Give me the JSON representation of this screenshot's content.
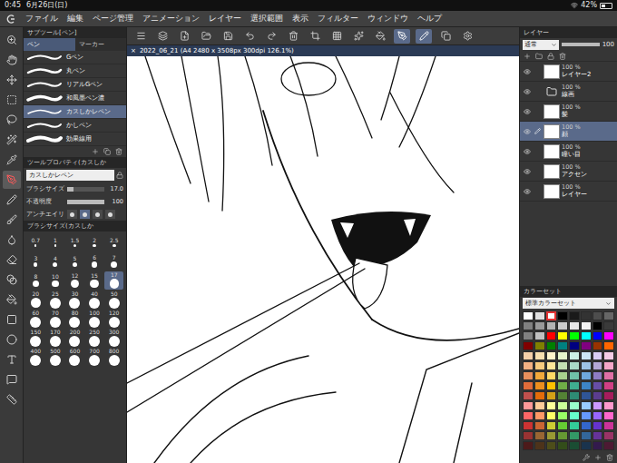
{
  "status_bar": {
    "time": "0:45",
    "date": "6月26日(日)",
    "battery": "42%",
    "battery_level": 0.42
  },
  "menu": {
    "items": [
      "ファイル",
      "編集",
      "ページ管理",
      "アニメーション",
      "レイヤー",
      "選択範囲",
      "表示",
      "フィルター",
      "ウィンドウ",
      "ヘルプ"
    ]
  },
  "tools": [
    {
      "selected": false
    },
    {
      "selected": false
    },
    {
      "selected": false
    },
    {
      "selected": false
    },
    {
      "selected": false
    },
    {
      "selected": false
    },
    {
      "selected": false
    },
    {
      "selected": true
    },
    {
      "selected": false
    },
    {
      "selected": false
    },
    {
      "selected": false
    },
    {
      "selected": false
    },
    {
      "selected": false
    },
    {
      "selected": false
    },
    {
      "selected": false
    },
    {
      "selected": false
    },
    {
      "selected": false
    },
    {
      "selected": false
    },
    {
      "selected": false
    }
  ],
  "toolbar": [
    {
      "selected": false
    },
    {
      "selected": false
    },
    {
      "selected": false
    },
    {
      "selected": false
    },
    {
      "selected": false
    },
    {
      "selected": false
    },
    {
      "selected": false
    },
    {
      "selected": false
    },
    {
      "selected": false
    },
    {
      "selected": false
    },
    {
      "selected": false
    },
    {
      "selected": false
    },
    {
      "selected": true
    },
    {
      "selected": true
    },
    {
      "selected": false
    },
    {
      "selected": false
    }
  ],
  "canvas": {
    "tab_close": "×",
    "title": "2022_06_21 (A4 2480 x 3508px 300dpi 126.1%)"
  },
  "subtool_panel": {
    "title": "サブツール[ペン]",
    "tabs": [
      {
        "label": "ペン",
        "selected": true
      },
      {
        "label": "マーカー",
        "selected": false
      }
    ],
    "brushes": [
      {
        "name": "Gペン",
        "selected": false
      },
      {
        "name": "丸ペン",
        "selected": false
      },
      {
        "name": "リアルGペン",
        "selected": false
      },
      {
        "name": "和風墨ペン濃",
        "selected": false
      },
      {
        "name": "カスしかレペン",
        "selected": true
      },
      {
        "name": "かしペン",
        "selected": false
      },
      {
        "name": "効果線用",
        "selected": false
      }
    ]
  },
  "tool_property": {
    "title": "ツールプロパティ(カスしか",
    "brush_name": "カスしかレペン",
    "sliders": [
      {
        "label": "ブラシサイズ",
        "value": "17.0",
        "level": 0.17
      },
      {
        "label": "不透明度",
        "value": "100",
        "level": 1
      }
    ],
    "antialias": {
      "label": "アンチエイリ",
      "options": [
        {
          "selected": false
        },
        {
          "selected": true
        },
        {
          "selected": false
        },
        {
          "selected": false
        }
      ]
    }
  },
  "brush_size_panel": {
    "title": "ブラシサイズ(カスしか",
    "sizes": [
      {
        "value": "0.7",
        "selected": false
      },
      {
        "value": "1",
        "selected": false
      },
      {
        "value": "1.5",
        "selected": false
      },
      {
        "value": "2",
        "selected": false
      },
      {
        "value": "2.5",
        "selected": false
      },
      {
        "value": "3",
        "selected": false
      },
      {
        "value": "4",
        "selected": false
      },
      {
        "value": "5",
        "selected": false
      },
      {
        "value": "6",
        "selected": false
      },
      {
        "value": "7",
        "selected": false
      },
      {
        "value": "8",
        "selected": false
      },
      {
        "value": "10",
        "selected": false
      },
      {
        "value": "12",
        "selected": false
      },
      {
        "value": "15",
        "selected": false
      },
      {
        "value": "17",
        "selected": true
      },
      {
        "value": "20",
        "selected": false
      },
      {
        "value": "25",
        "selected": false
      },
      {
        "value": "30",
        "selected": false
      },
      {
        "value": "40",
        "selected": false
      },
      {
        "value": "50",
        "selected": false
      },
      {
        "value": "60",
        "selected": false
      },
      {
        "value": "70",
        "selected": false
      },
      {
        "value": "80",
        "selected": false
      },
      {
        "value": "100",
        "selected": false
      },
      {
        "value": "120",
        "selected": false
      },
      {
        "value": "150",
        "selected": false
      },
      {
        "value": "170",
        "selected": false
      },
      {
        "value": "200",
        "selected": false
      },
      {
        "value": "250",
        "selected": false
      },
      {
        "value": "300",
        "selected": false
      },
      {
        "value": "400",
        "selected": false
      },
      {
        "value": "500",
        "selected": false
      },
      {
        "value": "600",
        "selected": false
      },
      {
        "value": "700",
        "selected": false
      },
      {
        "value": "800",
        "selected": false
      }
    ]
  },
  "layer_panel": {
    "title": "レイヤー",
    "blend_mode": "通常",
    "opacity": "100",
    "opacity_level": 1,
    "layers": [
      {
        "opacity": "100 %",
        "name": "レイヤー2",
        "kind": "layer",
        "visible": true,
        "selected": false
      },
      {
        "opacity": "100 %",
        "name": "線画",
        "kind": "folder",
        "visible": true,
        "selected": false
      },
      {
        "opacity": "100 %",
        "name": "髪",
        "kind": "layer",
        "visible": true,
        "selected": false
      },
      {
        "opacity": "100 %",
        "name": "顔",
        "kind": "layer",
        "visible": true,
        "selected": true
      },
      {
        "opacity": "100 %",
        "name": "瞳い目",
        "kind": "layer",
        "visible": true,
        "selected": false
      },
      {
        "opacity": "100 %",
        "name": "アクセン",
        "kind": "layer",
        "visible": true,
        "selected": false
      },
      {
        "opacity": "100 %",
        "name": "レイヤー",
        "kind": "layer",
        "visible": true,
        "selected": false
      }
    ]
  },
  "color_panel": {
    "title": "カラーセット",
    "set_name": "標準カラーセット",
    "swatches": [
      {
        "color": "#ffffff",
        "selected": false
      },
      {
        "color": "#e0e0e0",
        "selected": false
      },
      {
        "color": "#ffffff",
        "selected": true
      },
      {
        "color": "#000000",
        "selected": false
      },
      {
        "color": "#1a1a1a",
        "selected": false
      },
      {
        "color": "#333333",
        "selected": false
      },
      {
        "color": "#4d4d4d",
        "selected": false
      },
      {
        "color": "#666666",
        "selected": false
      },
      {
        "color": "#808080",
        "selected": false
      },
      {
        "color": "#999999",
        "selected": false
      },
      {
        "color": "#b3b3b3",
        "selected": false
      },
      {
        "color": "#cccccc",
        "selected": false
      },
      {
        "color": "#e6e6e6",
        "selected": false
      },
      {
        "color": "#f2f2f2",
        "selected": false
      },
      {
        "color": "#000000",
        "selected": false
      },
      {
        "color": "#3a3a3a",
        "selected": false
      },
      {
        "color": "#808080",
        "selected": false
      },
      {
        "color": "#c0c0c0",
        "selected": false
      },
      {
        "color": "#ff0000",
        "selected": false
      },
      {
        "color": "#ffff00",
        "selected": false
      },
      {
        "color": "#00ff00",
        "selected": false
      },
      {
        "color": "#00ffff",
        "selected": false
      },
      {
        "color": "#0000ff",
        "selected": false
      },
      {
        "color": "#ff00ff",
        "selected": false
      },
      {
        "color": "#800000",
        "selected": false
      },
      {
        "color": "#808000",
        "selected": false
      },
      {
        "color": "#008000",
        "selected": false
      },
      {
        "color": "#008080",
        "selected": false
      },
      {
        "color": "#000080",
        "selected": false
      },
      {
        "color": "#800080",
        "selected": false
      },
      {
        "color": "#993300",
        "selected": false
      },
      {
        "color": "#ff6600",
        "selected": false
      },
      {
        "color": "#f5d0a9",
        "selected": false
      },
      {
        "color": "#f8e0b0",
        "selected": false
      },
      {
        "color": "#fff5cc",
        "selected": false
      },
      {
        "color": "#e6f5cc",
        "selected": false
      },
      {
        "color": "#ccf0e6",
        "selected": false
      },
      {
        "color": "#cce6f5",
        "selected": false
      },
      {
        "color": "#d9ccf5",
        "selected": false
      },
      {
        "color": "#f5cce6",
        "selected": false
      },
      {
        "color": "#f4b183",
        "selected": false
      },
      {
        "color": "#f8cb7f",
        "selected": false
      },
      {
        "color": "#ffe699",
        "selected": false
      },
      {
        "color": "#c5e0b4",
        "selected": false
      },
      {
        "color": "#a9d9c7",
        "selected": false
      },
      {
        "color": "#9dc3e6",
        "selected": false
      },
      {
        "color": "#b4a7d6",
        "selected": false
      },
      {
        "color": "#f4a6c8",
        "selected": false
      },
      {
        "color": "#e88f5c",
        "selected": false
      },
      {
        "color": "#f2a93b",
        "selected": false
      },
      {
        "color": "#ffd966",
        "selected": false
      },
      {
        "color": "#a9d18e",
        "selected": false
      },
      {
        "color": "#70c1a8",
        "selected": false
      },
      {
        "color": "#6fa8dc",
        "selected": false
      },
      {
        "color": "#8e7cc3",
        "selected": false
      },
      {
        "color": "#e06fa5",
        "selected": false
      },
      {
        "color": "#e06c3a",
        "selected": false
      },
      {
        "color": "#ed8f1e",
        "selected": false
      },
      {
        "color": "#ffc000",
        "selected": false
      },
      {
        "color": "#70ad47",
        "selected": false
      },
      {
        "color": "#3fae8f",
        "selected": false
      },
      {
        "color": "#3d85c6",
        "selected": false
      },
      {
        "color": "#674ea7",
        "selected": false
      },
      {
        "color": "#d03f84",
        "selected": false
      },
      {
        "color": "#c0504d",
        "selected": false
      },
      {
        "color": "#e46c0a",
        "selected": false
      },
      {
        "color": "#d4a017",
        "selected": false
      },
      {
        "color": "#548235",
        "selected": false
      },
      {
        "color": "#2e8b74",
        "selected": false
      },
      {
        "color": "#2f5597",
        "selected": false
      },
      {
        "color": "#5b3d8f",
        "selected": false
      },
      {
        "color": "#a61c5c",
        "selected": false
      },
      {
        "color": "#ff9999",
        "selected": false
      },
      {
        "color": "#ffcc99",
        "selected": false
      },
      {
        "color": "#ffff99",
        "selected": false
      },
      {
        "color": "#ccff99",
        "selected": false
      },
      {
        "color": "#99ffcc",
        "selected": false
      },
      {
        "color": "#99ccff",
        "selected": false
      },
      {
        "color": "#cc99ff",
        "selected": false
      },
      {
        "color": "#ff99cc",
        "selected": false
      },
      {
        "color": "#ff6666",
        "selected": false
      },
      {
        "color": "#ff9966",
        "selected": false
      },
      {
        "color": "#ffff66",
        "selected": false
      },
      {
        "color": "#99ff66",
        "selected": false
      },
      {
        "color": "#66ffcc",
        "selected": false
      },
      {
        "color": "#6699ff",
        "selected": false
      },
      {
        "color": "#9966ff",
        "selected": false
      },
      {
        "color": "#ff66cc",
        "selected": false
      },
      {
        "color": "#cc3333",
        "selected": false
      },
      {
        "color": "#cc6633",
        "selected": false
      },
      {
        "color": "#cccc33",
        "selected": false
      },
      {
        "color": "#66cc33",
        "selected": false
      },
      {
        "color": "#33cc99",
        "selected": false
      },
      {
        "color": "#3366cc",
        "selected": false
      },
      {
        "color": "#6633cc",
        "selected": false
      },
      {
        "color": "#cc3399",
        "selected": false
      },
      {
        "color": "#993333",
        "selected": false
      },
      {
        "color": "#996633",
        "selected": false
      },
      {
        "color": "#999933",
        "selected": false
      },
      {
        "color": "#669933",
        "selected": false
      },
      {
        "color": "#339966",
        "selected": false
      },
      {
        "color": "#336699",
        "selected": false
      },
      {
        "color": "#663399",
        "selected": false
      },
      {
        "color": "#993366",
        "selected": false
      },
      {
        "color": "#4d1a1a",
        "selected": false
      },
      {
        "color": "#4d331a",
        "selected": false
      },
      {
        "color": "#4d4d1a",
        "selected": false
      },
      {
        "color": "#334d1a",
        "selected": false
      },
      {
        "color": "#1a4d33",
        "selected": false
      },
      {
        "color": "#1a334d",
        "selected": false
      },
      {
        "color": "#331a4d",
        "selected": false
      },
      {
        "color": "#4d1a33",
        "selected": false
      }
    ]
  }
}
